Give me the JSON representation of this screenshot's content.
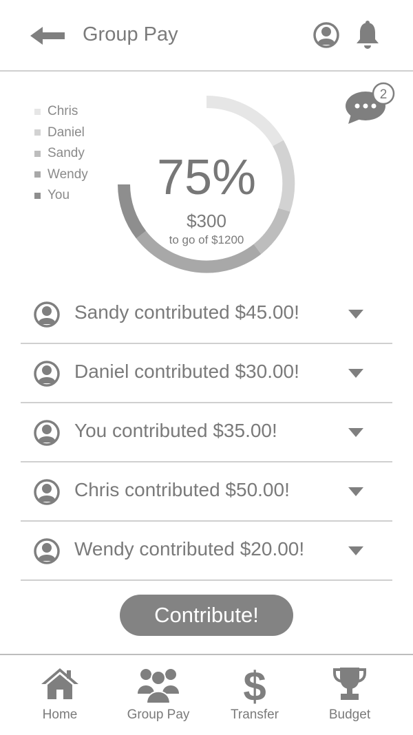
{
  "header": {
    "title": "Group Pay"
  },
  "legend": [
    {
      "name": "Chris",
      "color": "#e6e6e6"
    },
    {
      "name": "Daniel",
      "color": "#d2d2d2"
    },
    {
      "name": "Sandy",
      "color": "#bdbdbd"
    },
    {
      "name": "Wendy",
      "color": "#a8a8a8"
    },
    {
      "name": "You",
      "color": "#8e8e8e"
    }
  ],
  "progress": {
    "percent": "75%",
    "percent_value": 0.75,
    "remaining": "$300",
    "subtitle": "to go of $1200"
  },
  "chat": {
    "badge": "2"
  },
  "contributions": [
    {
      "text": "Sandy contributed $45.00!"
    },
    {
      "text": "Daniel contributed $30.00!"
    },
    {
      "text": "You contributed $35.00!"
    },
    {
      "text": "Chris contributed $50.00!"
    },
    {
      "text": "Wendy contributed $20.00!"
    }
  ],
  "cta": {
    "label": "Contribute!"
  },
  "tabs": [
    {
      "label": "Home",
      "icon": "home-icon"
    },
    {
      "label": "Group Pay",
      "icon": "group-icon"
    },
    {
      "label": "Transfer",
      "icon": "dollar-icon"
    },
    {
      "label": "Budget",
      "icon": "trophy-icon"
    }
  ],
  "colors": {
    "icon": "#7f7f7f",
    "divider": "#cfcfcf",
    "button": "#838383"
  }
}
